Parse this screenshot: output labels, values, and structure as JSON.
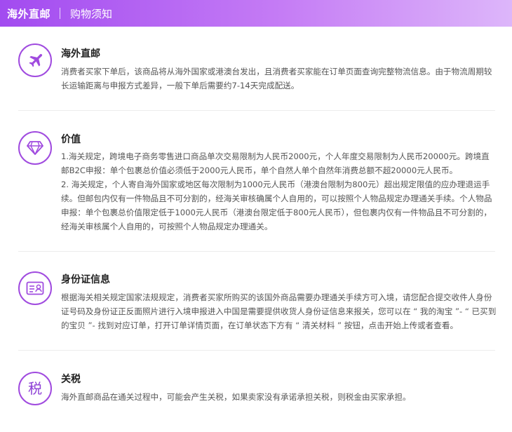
{
  "header": {
    "title": "海外直邮",
    "subtitle": "购物须知"
  },
  "sections": [
    {
      "icon": "airplane-icon",
      "title": "海外直邮",
      "body": "消费者买家下单后，该商品将从海外国家或港澳台发出，且消费者买家能在订单页面查询完整物流信息。由于物流周期较长运输距离与申报方式差异，一般下单后需要约7-14天完成配送。"
    },
    {
      "icon": "diamond-icon",
      "title": "价值",
      "body_lines": [
        "1.海关规定，跨境电子商务零售进口商品单次交易限制为人民币2000元，个人年度交易限制为人民币20000元。跨境直邮B2C申报：单个包裹总价值必须低于2000元人民币，单个自然人单个自然年消费总额不超20000元人民币。",
        "2. 海关规定，个人寄自海外国家或地区每次限制为1000元人民币（港澳台限制为800元）超出规定限值的应办理退运手续。但邮包内仅有一件物品且不可分割的，经海关审核确属个人自用的，可以按照个人物品规定办理通关手续。个人物品申报：单个包裹总价值限定低于1000元人民币（港澳台限定低于800元人民币），但包裹内仅有一件物品且不可分割的，经海关审核属个人自用的，可按照个人物品规定办理通关。"
      ]
    },
    {
      "icon": "id-card-icon",
      "title": "身份证信息",
      "body": "根据海关相关规定国家法规规定，消费者买家所购买的该国外商品需要办理通关手续方可入境，请您配合提交收件人身份证号码及身份证正反面照片进行入境申报进入中国是需要提供收货人身份证信息来报关，您可以在 “ 我的淘宝 ”- “ 已买到的宝贝 ”- 找到对应订单，打开订单详情页面，在订单状态下方有 “ 清关材料 ” 按钮，点击开始上传或者查看。"
    },
    {
      "icon": "tax-icon",
      "icon_char": "税",
      "title": "关税",
      "body": "海外直邮商品在通关过程中，可能会产生关税，如果卖家没有承诺承担关税，则税金由买家承担。"
    }
  ],
  "colors": {
    "accent": "#a04bdf",
    "header_start": "#a24bf0",
    "header_end": "#ddb6fa"
  }
}
